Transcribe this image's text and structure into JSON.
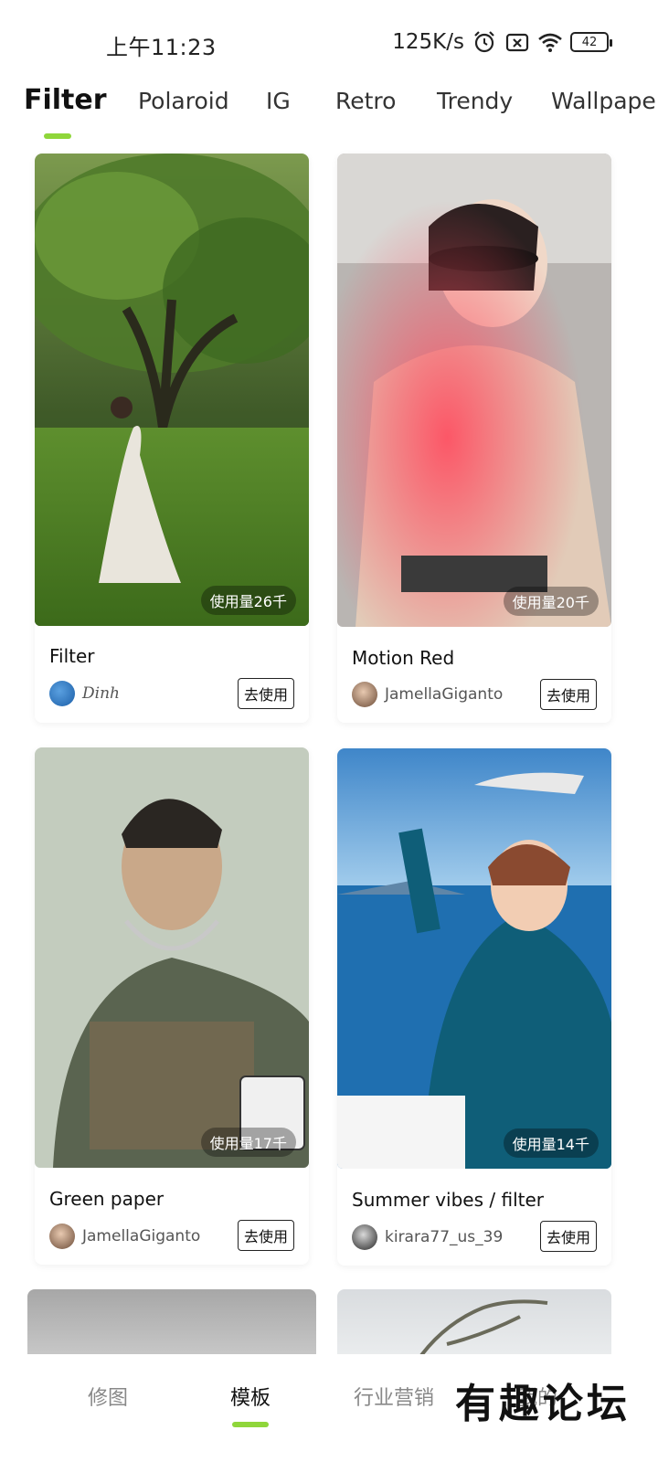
{
  "status_bar": {
    "time": "上午11:23",
    "net_speed": "125K/s",
    "battery": "42"
  },
  "tabs": [
    {
      "label": "Filter",
      "active": true
    },
    {
      "label": "Polaroid",
      "active": false
    },
    {
      "label": "IG",
      "active": false
    },
    {
      "label": "Retro",
      "active": false
    },
    {
      "label": "Trendy",
      "active": false
    },
    {
      "label": "Wallpaper",
      "active": false
    }
  ],
  "cards": [
    {
      "title": "Filter",
      "author": "Dinh",
      "usage": "使用量26千",
      "button": "去使用"
    },
    {
      "title": "Motion Red",
      "author": "JamellaGiganto",
      "usage": "使用量20千",
      "button": "去使用"
    },
    {
      "title": "Green paper",
      "author": "JamellaGiganto",
      "usage": "使用量17千",
      "button": "去使用"
    },
    {
      "title": "Summer vibes / filter",
      "author": "kirara77_us_39",
      "usage": "使用量14千",
      "button": "去使用"
    }
  ],
  "bottom_nav": [
    {
      "label": "修图",
      "active": false
    },
    {
      "label": "模板",
      "active": true
    },
    {
      "label": "行业营销",
      "active": false
    },
    {
      "label": "我的",
      "active": false
    }
  ],
  "watermark": "有趣论坛",
  "colors": {
    "accent": "#8fd63a",
    "text": "#111111",
    "muted": "#888888"
  }
}
